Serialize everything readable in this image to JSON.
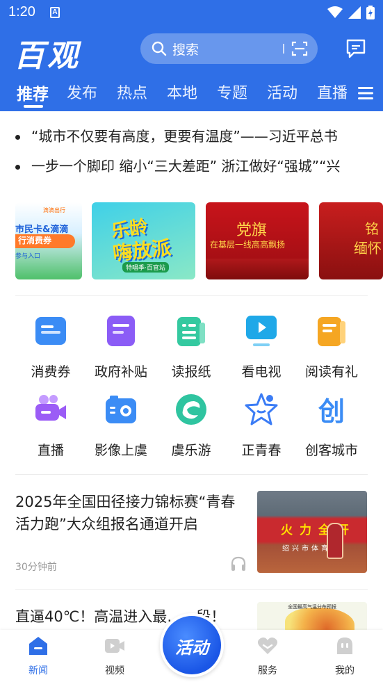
{
  "status_bar": {
    "time": "1:20",
    "notification_letter": "A"
  },
  "header": {
    "logo_text": "百观",
    "search_placeholder": "搜索"
  },
  "tabs": [
    "推荐",
    "发布",
    "热点",
    "本地",
    "专题",
    "活动",
    "直播"
  ],
  "headlines": [
    "“城市不仅要有高度，更要有温度”——习近平总书",
    "一步一个脚印 缩小“三大差距” 浙江做好“强城”“兴"
  ],
  "banners": [
    {
      "brand": "滴滴出行",
      "line1": "市民卡&滴滴",
      "line2": "行消费券",
      "line3": "参与入口"
    },
    {
      "line1": "乐龄",
      "line2": "嗨放派",
      "line3": "特唱季·百官站"
    },
    {
      "line1": "党旗",
      "line2": "在基层一线高高飘扬"
    },
    {
      "line1": "铭",
      "line2": "缅怀"
    }
  ],
  "services": [
    {
      "label": "消费券",
      "icon": "voucher-icon",
      "color": "#3b8cf5"
    },
    {
      "label": "政府补贴",
      "icon": "subsidy-icon",
      "color": "#8b5cf6"
    },
    {
      "label": "读报纸",
      "icon": "newspaper-icon",
      "color": "#34c9a0"
    },
    {
      "label": "看电视",
      "icon": "tv-icon",
      "color": "#1fa8e8"
    },
    {
      "label": "阅读有礼",
      "icon": "reading-gift-icon",
      "color": "#f5a623"
    },
    {
      "label": "直播",
      "icon": "live-camera-icon",
      "color": "#9b5cf6"
    },
    {
      "label": "影像上虞",
      "icon": "radio-camera-icon",
      "color": "#3b8cf5"
    },
    {
      "label": "虞乐游",
      "icon": "travel-swirl-icon",
      "color": "#2fc4a0"
    },
    {
      "label": "正青春",
      "icon": "youth-star-icon",
      "color": "#3b7cf5"
    },
    {
      "label": "创客城市",
      "icon": "maker-city-icon",
      "color": "#3b8cf5"
    }
  ],
  "news": [
    {
      "title": "2025年全国田径接力锦标赛“青春活力跑”大众组报名通道开启",
      "time": "30分钟前",
      "thumb_text": "火力全开",
      "thumb_sub": "绍兴市体育"
    },
    {
      "title": "直逼40℃！高温进入最……段！",
      "thumb_caption": "全国最高气温分布预报"
    }
  ],
  "bottom_nav": {
    "items": [
      {
        "label": "新闻",
        "icon": "news-home-icon",
        "active": true
      },
      {
        "label": "视频",
        "icon": "video-icon",
        "active": false
      },
      {
        "label": "服务",
        "icon": "heart-service-icon",
        "active": false
      },
      {
        "label": "我的",
        "icon": "profile-icon",
        "active": false
      }
    ],
    "center_label": "活动"
  },
  "colors": {
    "brand_blue": "#2f6fe7",
    "active_nav": "#2f6fe7"
  }
}
